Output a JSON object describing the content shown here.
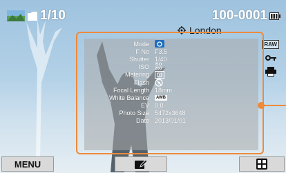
{
  "header": {
    "image_counter": "1/10",
    "file_number": "100-0001",
    "location": "London"
  },
  "side_icons": [
    "raw-badge",
    "key-icon",
    "print-icon"
  ],
  "side_raw_label": "RAW",
  "info": {
    "labels": {
      "mode": "Mode",
      "fno": "F No",
      "shutter": "Shutter",
      "iso": "ISO",
      "metering": "Metering",
      "flash": "Flash",
      "focal": "Focal Length",
      "wb": "White Balance",
      "ev": "EV",
      "photo_size": "Photo Size",
      "date": "Date"
    },
    "values": {
      "mode_icon": "smart-auto-icon",
      "fno": "F3.5",
      "shutter": "1/40",
      "iso_top": "ISO",
      "iso_bottom": "200",
      "metering_icon": "metering-icon",
      "flash_icon": "flash-off-icon",
      "focal": "18mm",
      "wb_badge": "AWB",
      "ev": "0.0",
      "photo_size": "5472x3648",
      "date": "2013/01/01"
    }
  },
  "bottom": {
    "menu_label": "MENU"
  },
  "colors": {
    "accent": "#ee8a3a",
    "panel": "#aaaaaa",
    "sky": "#b3d1e7"
  }
}
